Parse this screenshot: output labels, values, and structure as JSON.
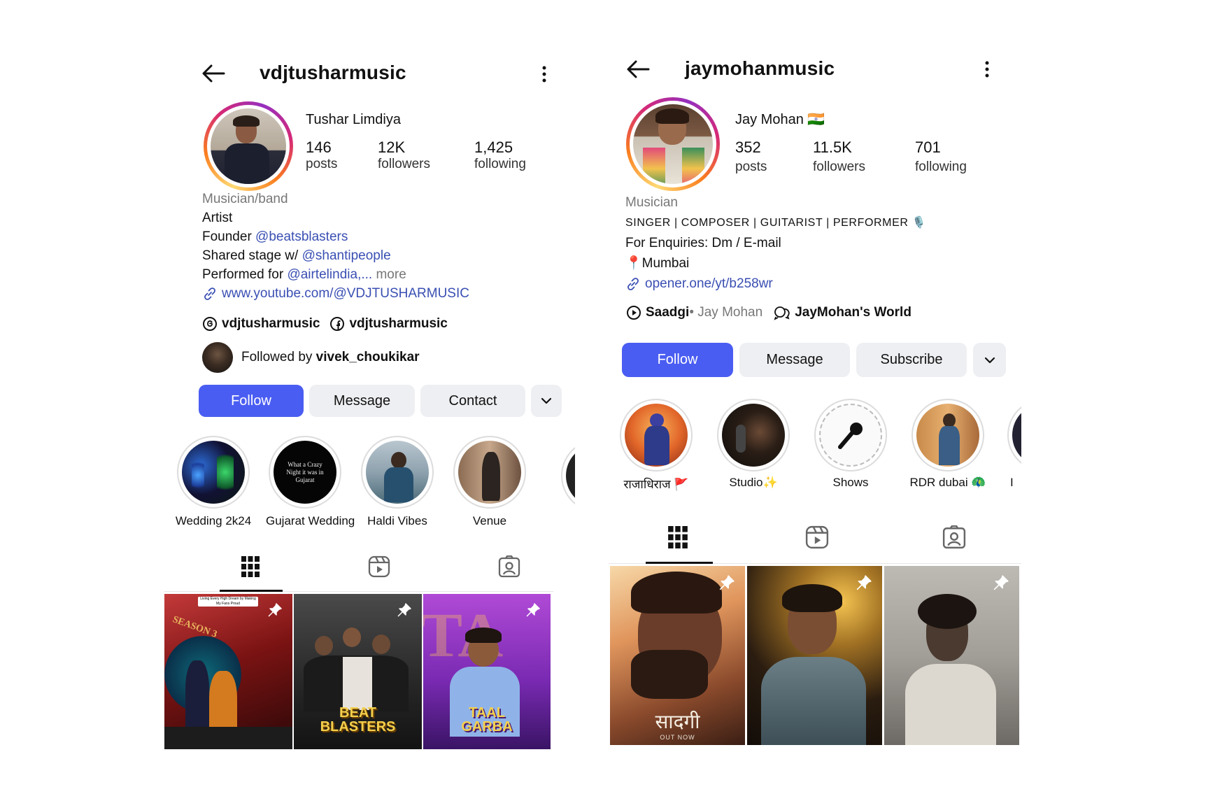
{
  "profiles": [
    {
      "username": "vdjtusharmusic",
      "display_name": "Tushar Limdiya",
      "stats": [
        {
          "value": "146",
          "label": "posts"
        },
        {
          "value": "12K",
          "label": "followers"
        },
        {
          "value": "1,425",
          "label": "following"
        }
      ],
      "category": "Musician/band",
      "bio": {
        "line1": "Artist",
        "line2_prefix": "Founder ",
        "line2_mention": "@beatsblasters",
        "line3_prefix": "Shared stage w/ ",
        "line3_mention": "@shantipeople",
        "line4_prefix": "Performed for ",
        "line4_mention": "@airtelindia",
        "line4_ellipsis": ",...",
        "line4_more": " more"
      },
      "link": "www.youtube.com/@VDJTUSHARMUSIC",
      "threads_handle": "vdjtusharmusic",
      "facebook_handle": "vdjtusharmusic",
      "followed_by_prefix": "Followed by ",
      "followed_by_user": "vivek_choukikar",
      "buttons": {
        "follow": "Follow",
        "message": "Message",
        "contact": "Contact"
      },
      "highlights": [
        "Wedding 2k24",
        "Gujarat Wedding",
        "Haldi Vibes",
        "Venue"
      ],
      "highlight_text_in_story": "What a Crazy Night it was in Gujarat",
      "posts": [
        {
          "overlay": "Living Every High Dream by Making My Fans Proud",
          "caption": "SEASON 3",
          "pinned": true
        },
        {
          "overlay": "BEAT BLASTERS",
          "caption_line1": "BEAT",
          "caption_line2": "BLASTERS",
          "pinned": true
        },
        {
          "overlay": "TAAL GARBA",
          "caption_line1": "TAAL",
          "caption_line2": "GARBA",
          "pinned": true
        }
      ]
    },
    {
      "username": "jaymohanmusic",
      "display_name": "Jay Mohan 🇮🇳",
      "stats": [
        {
          "value": "352",
          "label": "posts"
        },
        {
          "value": "11.5K",
          "label": "followers"
        },
        {
          "value": "701",
          "label": "following"
        }
      ],
      "category": "Musician",
      "bio": {
        "line1": "SINGER | COMPOSER | GUITARIST | PERFORMER 🎙️",
        "line2": "For Enquiries: Dm / E-mail",
        "line3": "📍Mumbai"
      },
      "link": "opener.one/yt/b258wr",
      "music_title": "Saadgi",
      "music_artist": " • Jay Mohan",
      "channel_name": "JayMohan's World",
      "buttons": {
        "follow": "Follow",
        "message": "Message",
        "subscribe": "Subscribe"
      },
      "highlights": [
        "राजाधिराज 🚩",
        "Studio✨",
        "Shows",
        "RDR dubai 🦚",
        "I"
      ],
      "posts": [
        {
          "caption": "सादगी",
          "sub": "OUT NOW",
          "pinned": true
        },
        {
          "pinned": true
        },
        {
          "pinned": true
        }
      ]
    }
  ]
}
